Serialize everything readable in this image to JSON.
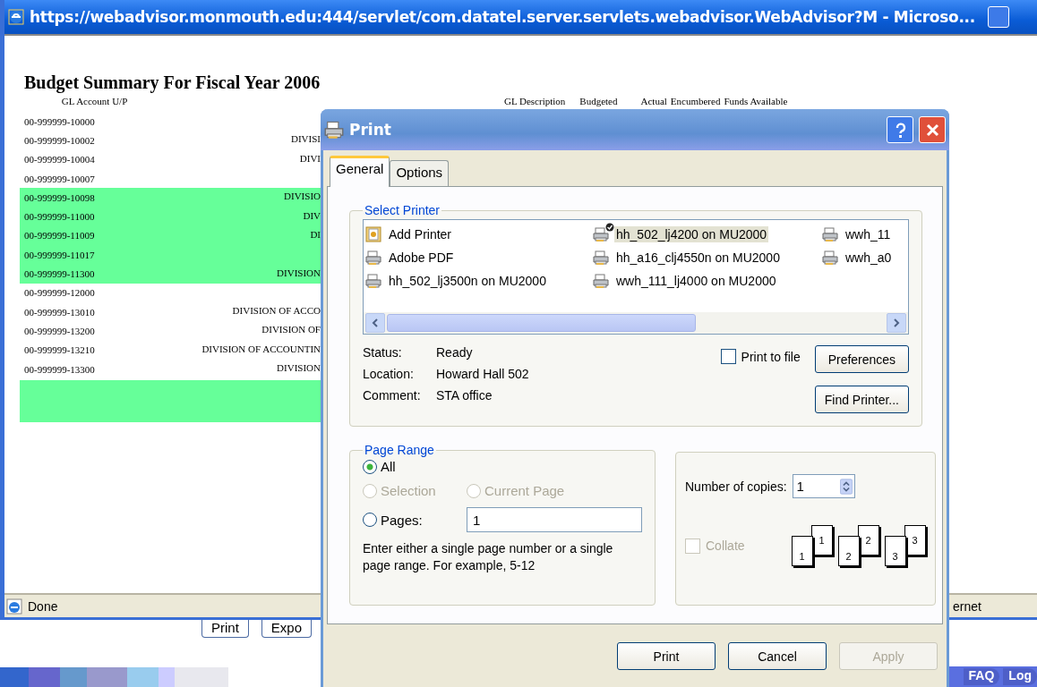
{
  "browser": {
    "title": "https://webadvisor.monmouth.edu:444/servlet/com.datatel.server.servlets.webadvisor.WebAdvisor?M - Microso...",
    "status": "Done",
    "status_zone": "ernet"
  },
  "page": {
    "heading": "Budget Summary For Fiscal Year 2006",
    "columns": [
      "GL Account U/P",
      "GL Description",
      "Budgeted",
      "Actual",
      "Encumbered",
      "Funds Available"
    ],
    "rows": [
      {
        "account": "00-999999-10000",
        "highlighted": false
      },
      {
        "account": "00-999999-10002",
        "description": "DIVISI",
        "highlighted": false
      },
      {
        "account": "00-999999-10004",
        "description": "DIVI",
        "highlighted": false
      },
      {
        "account": "00-999999-10007",
        "highlighted": false
      },
      {
        "account": "00-999999-10098",
        "description": "DIVISIO",
        "highlighted": true
      },
      {
        "account": "00-999999-11000",
        "description": "DIV",
        "highlighted": true
      },
      {
        "account": "00-999999-11009",
        "description": "DI",
        "highlighted": true
      },
      {
        "account": "00-999999-11017",
        "highlighted": true
      },
      {
        "account": "00-999999-11300",
        "description": "DIVISION",
        "highlighted": true
      },
      {
        "account": "00-999999-12000",
        "highlighted": false
      },
      {
        "account": "00-999999-13010",
        "description": "DIVISION OF ACCO",
        "highlighted": false
      },
      {
        "account": "00-999999-13200",
        "description": "DIVISION OF",
        "highlighted": false
      },
      {
        "account": "00-999999-13210",
        "description": "DIVISION OF ACCOUNTIN",
        "highlighted": false
      },
      {
        "account": "00-999999-13300",
        "description": "DIVISION",
        "highlighted": false
      }
    ],
    "summary_row": {
      "highlighted": true
    },
    "buttons": [
      "Print",
      "Expo"
    ]
  },
  "dialog": {
    "title": "Print",
    "tabs": [
      {
        "label": "General",
        "selected": true
      },
      {
        "label": "Options",
        "selected": false
      }
    ],
    "select_printer": {
      "label": "Select Printer",
      "printers": [
        {
          "name": "Add Printer",
          "kind": "add",
          "selected": false,
          "default": false
        },
        {
          "name": "Adobe PDF",
          "kind": "printer",
          "selected": false,
          "default": false
        },
        {
          "name": "hh_502_lj3500n on MU2000",
          "kind": "printer",
          "selected": false,
          "default": false
        },
        {
          "name": "hh_502_lj4200 on MU2000",
          "kind": "printer",
          "selected": true,
          "default": true
        },
        {
          "name": "hh_a16_clj4550n on MU2000",
          "kind": "printer",
          "selected": false,
          "default": false
        },
        {
          "name": "wwh_111_lj4000 on MU2000",
          "kind": "printer",
          "selected": false,
          "default": false
        },
        {
          "name": "wwh_11",
          "kind": "printer",
          "selected": false,
          "default": false
        },
        {
          "name": "wwh_a0",
          "kind": "printer",
          "selected": false,
          "default": false
        }
      ],
      "info": [
        {
          "label": "Status:",
          "value": "Ready"
        },
        {
          "label": "Location:",
          "value": "Howard Hall  502"
        },
        {
          "label": "Comment:",
          "value": "STA office"
        }
      ],
      "print_to_file": {
        "label": "Print to file",
        "checked": false
      },
      "buttons": [
        "Preferences",
        "Find Printer..."
      ]
    },
    "page_range": {
      "label": "Page Range",
      "options": [
        {
          "label": "All",
          "selected": true,
          "disabled": false
        },
        {
          "label": "Selection",
          "selected": false,
          "disabled": true
        },
        {
          "label": "Current Page",
          "selected": false,
          "disabled": true
        },
        {
          "label": "Pages:",
          "selected": false,
          "disabled": false
        }
      ],
      "pages_value": "1",
      "hint": "Enter either a single page number or a single page range.  For example, 5-12"
    },
    "copies": {
      "label": "Number of copies:",
      "value": "1",
      "collate": {
        "label": "Collate",
        "checked": false,
        "disabled": true
      },
      "collate_sheets": [
        {
          "back": "1",
          "front": "1"
        },
        {
          "back": "2",
          "front": "2"
        },
        {
          "back": "3",
          "front": "3"
        }
      ]
    },
    "buttons": [
      {
        "label": "Print",
        "disabled": false
      },
      {
        "label": "Cancel",
        "disabled": false
      },
      {
        "label": "Apply",
        "disabled": true
      }
    ]
  },
  "footer": {
    "links": [
      "FAQ",
      "Log"
    ]
  }
}
